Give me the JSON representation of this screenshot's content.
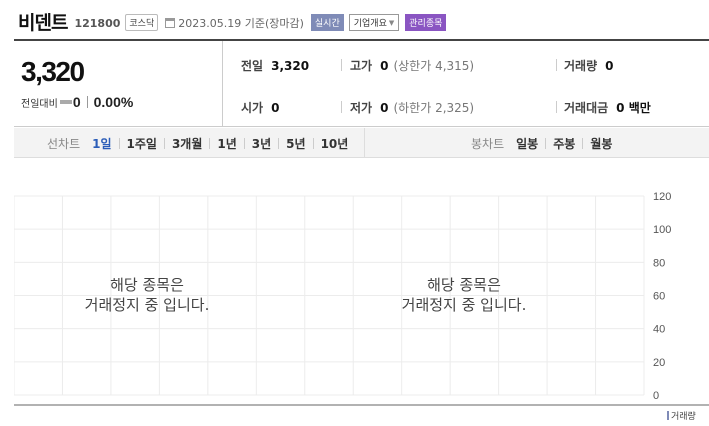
{
  "header": {
    "name": "비덴트",
    "code": "121800",
    "market": "코스닥",
    "date": "2023.05.19 기준(장마감)",
    "realtime_label": "실시간",
    "company_label": "기업개요",
    "managed_label": "관리종목"
  },
  "quote": {
    "price": "3,320",
    "change_label": "전일대비",
    "change": "0",
    "change_pct": "0.00%",
    "prev_close_label": "전일",
    "prev_close": "3,320",
    "high_label": "고가",
    "high": "0",
    "upper_limit": "(상한가 4,315)",
    "volume_label": "거래량",
    "volume": "0",
    "open_label": "시가",
    "open": "0",
    "low_label": "저가",
    "low": "0",
    "lower_limit": "(하한가 2,325)",
    "amount_label": "거래대금",
    "amount": "0 백만"
  },
  "tabs": {
    "line_title": "선차트",
    "line_periods": [
      "1일",
      "1주일",
      "3개월",
      "1년",
      "3년",
      "5년",
      "10년"
    ],
    "line_active": 0,
    "candle_title": "봉차트",
    "candle_periods": [
      "일봉",
      "주봉",
      "월봉"
    ]
  },
  "chart": {
    "halt_line1": "해당 종목은",
    "halt_line2": "거래정지 중 입니다.",
    "legend": "거래량",
    "legend_color": "#7f8bb7"
  },
  "chart_data": {
    "type": "bar",
    "categories": [],
    "series": [
      {
        "name": "거래량",
        "values": []
      }
    ],
    "yticks": [
      0,
      20,
      40,
      60,
      80,
      100,
      120
    ],
    "ylim": [
      0,
      120
    ],
    "grid": true,
    "legend_position": "bottom-right"
  }
}
